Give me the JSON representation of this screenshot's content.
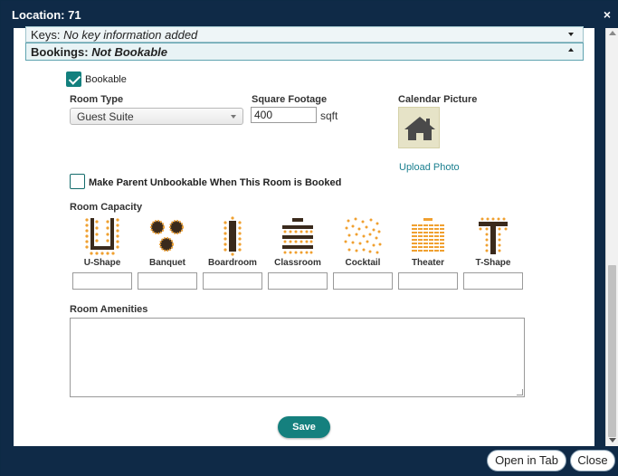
{
  "window": {
    "title": "Location: 71",
    "close_glyph": "×"
  },
  "accordions": {
    "keys": {
      "label": "Keys:",
      "value": "No key information added"
    },
    "bookings": {
      "label": "Bookings:",
      "value": "Not Bookable"
    }
  },
  "form": {
    "bookable": {
      "label": "Bookable",
      "checked": true
    },
    "room_type": {
      "label": "Room Type",
      "value": "Guest Suite"
    },
    "square_footage": {
      "label": "Square Footage",
      "value": "400",
      "unit": "sqft"
    },
    "calendar_picture": {
      "label": "Calendar Picture",
      "upload_label": "Upload Photo",
      "icon": "house-icon"
    },
    "parent_unbookable": {
      "label": "Make Parent Unbookable When This Room is Booked",
      "checked": false
    },
    "room_capacity": {
      "label": "Room Capacity",
      "layouts": [
        {
          "name": "U-Shape",
          "value": ""
        },
        {
          "name": "Banquet",
          "value": ""
        },
        {
          "name": "Boardroom",
          "value": ""
        },
        {
          "name": "Classroom",
          "value": ""
        },
        {
          "name": "Cocktail",
          "value": ""
        },
        {
          "name": "Theater",
          "value": ""
        },
        {
          "name": "T-Shape",
          "value": ""
        }
      ]
    },
    "room_amenities": {
      "label": "Room Amenities",
      "value": ""
    },
    "save_label": "Save"
  },
  "footer": {
    "open_in_tab": "Open in Tab",
    "close": "Close"
  },
  "colors": {
    "navy": "#0f2a47",
    "teal": "#15807e",
    "orange": "#f0a030",
    "dark_brown": "#3a2a1c"
  }
}
